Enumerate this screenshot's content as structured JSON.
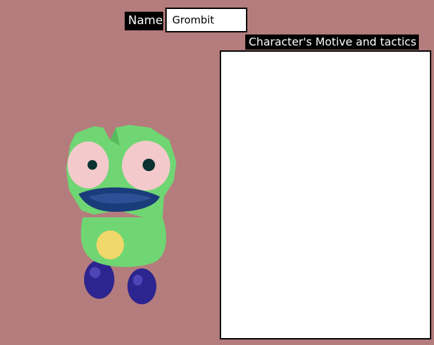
{
  "name_form": {
    "label": "Name",
    "value": "Grombit"
  },
  "motive_form": {
    "label": "Character's Motive and tactics",
    "value": ""
  },
  "character": {
    "model_icon": "frog-character-icon",
    "colors": {
      "body": "#6fd673",
      "eye_white": "#f4c9cc",
      "pupil": "#0b3331",
      "mouth": "#1b3c7a",
      "belly_spot": "#f1d86a",
      "feet": "#2c248f"
    }
  },
  "theme": {
    "background": "#b47c7c",
    "label_bg": "#000000",
    "label_fg": "#ffffff"
  }
}
